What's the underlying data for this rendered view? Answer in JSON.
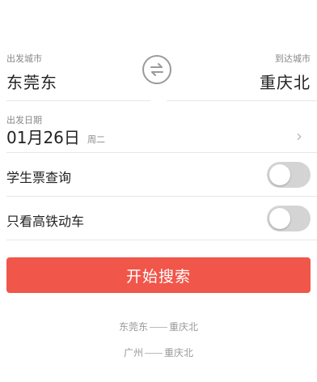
{
  "departure": {
    "label": "出发城市",
    "city": "东莞东"
  },
  "arrival": {
    "label": "到达城市",
    "city": "重庆北"
  },
  "date": {
    "label": "出发日期",
    "value": "01月26日",
    "weekday": "周二",
    "chevron": "›"
  },
  "student_ticket": {
    "label": "学生票查询",
    "enabled": false
  },
  "high_speed_only": {
    "label": "只看高铁动车",
    "enabled": false
  },
  "search_button": {
    "label": "开始搜索",
    "color": "#f0564a"
  },
  "history": [
    {
      "from": "东莞东",
      "to": "重庆北"
    },
    {
      "from": "广州",
      "to": "重庆北"
    }
  ],
  "icons": {
    "swap": "swap-arrows-icon",
    "chevron": "chevron-right-icon"
  }
}
